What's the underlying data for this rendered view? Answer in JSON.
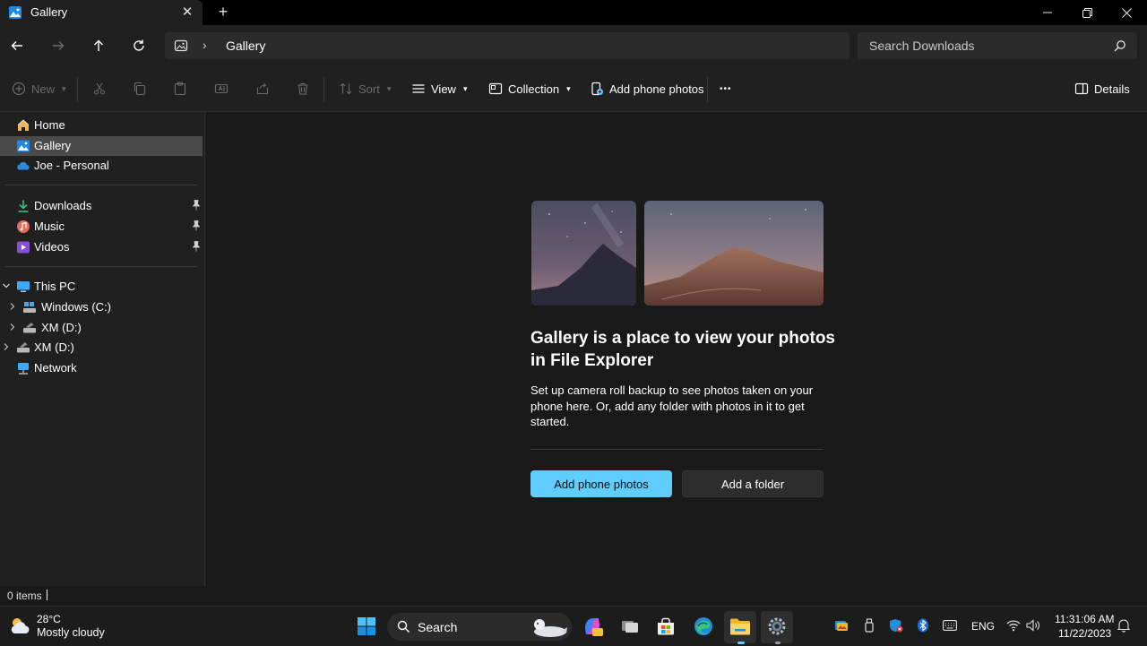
{
  "tab": {
    "title": "Gallery",
    "close_symbol": "✕",
    "new_tab_symbol": "+"
  },
  "address": {
    "crumb": "Gallery"
  },
  "search": {
    "placeholder": "Search Downloads"
  },
  "commandbar": {
    "new": "New",
    "sort": "Sort",
    "view": "View",
    "collection": "Collection",
    "add_phone_photos": "Add phone photos",
    "more": "•••",
    "details": "Details"
  },
  "sidebar": {
    "items": [
      {
        "label": "Home",
        "icon": "home-icon"
      },
      {
        "label": "Gallery",
        "icon": "gallery-icon",
        "selected": true
      },
      {
        "label": "Joe - Personal",
        "icon": "onedrive-icon"
      },
      {
        "label": "Downloads",
        "icon": "downloads-icon",
        "pinned": true
      },
      {
        "label": "Music",
        "icon": "music-icon",
        "pinned": true
      },
      {
        "label": "Videos",
        "icon": "videos-icon",
        "pinned": true
      },
      {
        "label": "This PC",
        "icon": "this-pc-icon",
        "expanded": true
      },
      {
        "label": "Windows (C:)",
        "icon": "drive-icon"
      },
      {
        "label": "XM (D:)",
        "icon": "usb-drive-icon"
      },
      {
        "label": "XM (D:)",
        "icon": "usb-drive-icon"
      },
      {
        "label": "Network",
        "icon": "network-icon"
      }
    ]
  },
  "main": {
    "headline": "Gallery is a place to view your photos in File Explorer",
    "description": "Set up camera roll backup to see photos taken on your phone here. Or, add any folder with photos in it to get started.",
    "primary_button": "Add phone photos",
    "secondary_button": "Add a folder"
  },
  "status": {
    "items": "0 items"
  },
  "taskbar": {
    "weather_temp": "28°C",
    "weather_condition": "Mostly cloudy",
    "search_label": "Search",
    "language": "ENG",
    "time": "11:31:06 AM",
    "date": "11/22/2023"
  },
  "colors": {
    "accent": "#60cdff",
    "background": "#191919",
    "chrome": "#202020",
    "selected": "#4a4a4a"
  }
}
